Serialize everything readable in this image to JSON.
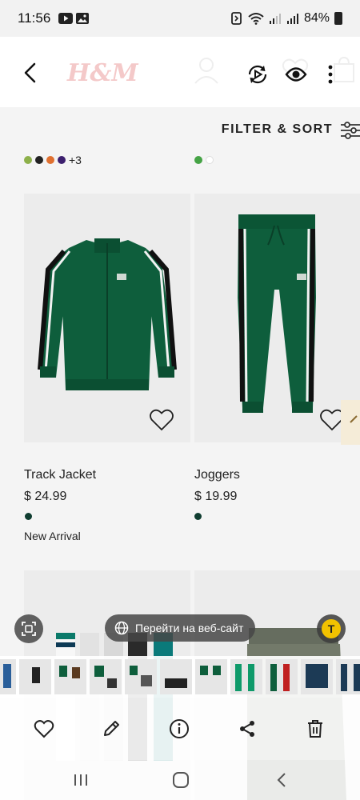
{
  "status_bar": {
    "time": "11:56",
    "battery": "84%"
  },
  "header": {
    "brand": "H&M"
  },
  "filter": {
    "label": "FILTER & SORT"
  },
  "products": [
    {
      "name": "Track Jacket",
      "price": "$ 24.99",
      "tag": "New Arrival",
      "swatches": [
        "#8db04a",
        "#222222",
        "#e07030",
        "#3c1f6e"
      ],
      "more_colors": "+3",
      "selected_color": "#0f3d30"
    },
    {
      "name": "Joggers",
      "price": "$ 19.99",
      "swatches": [
        "#45a345",
        "#ffffff"
      ],
      "selected_color": "#0f3d30"
    }
  ],
  "overlay": {
    "open_site_label": "Перейти на веб-сайт",
    "text_icon_letter": "T"
  },
  "colors": {
    "jacket_green": "#0e5e3c",
    "accent_yellow": "#f2c200"
  }
}
